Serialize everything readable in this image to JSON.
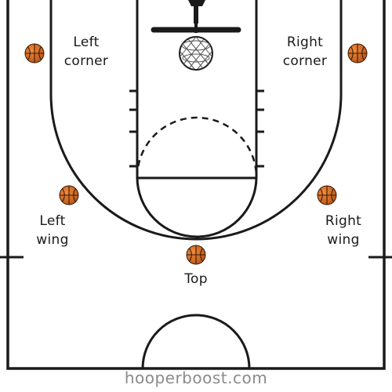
{
  "diagram": {
    "positions": {
      "left_corner": {
        "line1": "Left",
        "line2": "corner"
      },
      "right_corner": {
        "line1": "Right",
        "line2": "corner"
      },
      "left_wing": {
        "line1": "Left",
        "line2": "wing"
      },
      "right_wing": {
        "line1": "Right",
        "line2": "wing"
      },
      "top": {
        "line1": "Top"
      }
    },
    "watermark": "hooperboost.com",
    "colors": {
      "court_line": "#1a1a1a",
      "ball": "#d2691e",
      "ball_seam": "#3a1a08",
      "watermark": "#8a8a8a"
    },
    "icons": [
      "basketball-icon",
      "hoop-icon"
    ]
  }
}
